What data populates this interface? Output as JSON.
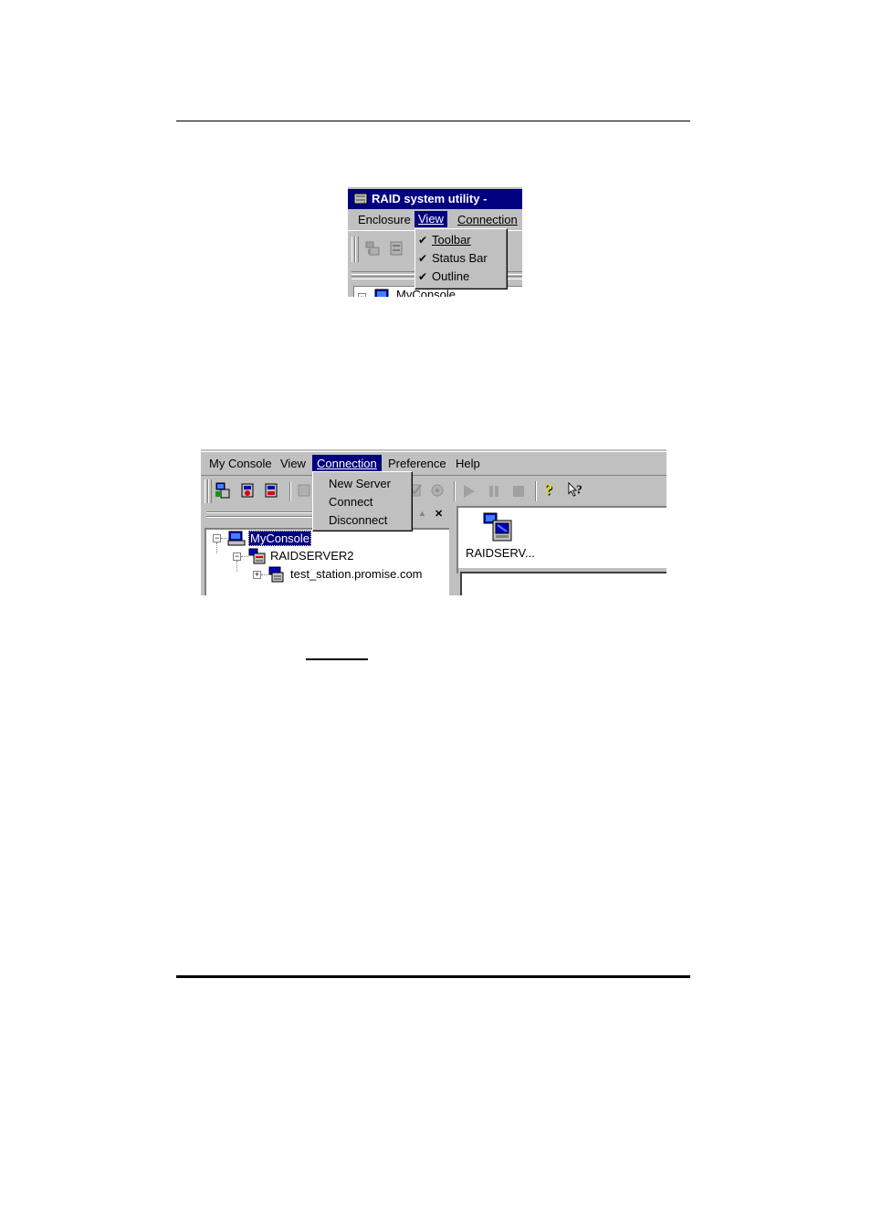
{
  "screenshot1": {
    "title": "RAID system utility -",
    "menu": [
      "Enclosure",
      "View",
      "Connection"
    ],
    "active_menu": "View",
    "view_menu_items": [
      {
        "label": "Toolbar",
        "checked": true,
        "accel_index": 0
      },
      {
        "label": "Status Bar",
        "checked": true,
        "accel_index": 0
      },
      {
        "label": "Outline",
        "checked": true,
        "accel_index": 0
      }
    ],
    "tree_root": "MyConsole"
  },
  "screenshot2": {
    "menu": [
      "My Console",
      "View",
      "Connection",
      "Preference",
      "Help"
    ],
    "active_menu": "Connection",
    "connection_menu_items": [
      "New Server",
      "Connect",
      "Disconnect"
    ],
    "pane_controls": [
      "▲",
      "✕"
    ],
    "tree": [
      {
        "label": "MyConsole",
        "selected": true,
        "expander": "−"
      },
      {
        "label": "RAIDSERVER2",
        "selected": false,
        "expander": "−"
      },
      {
        "label": "test_station.promise.com",
        "selected": false,
        "expander": "+"
      }
    ],
    "right_pane_item": "RAIDSERV..."
  },
  "colors": {
    "window_face": "#c0c0c0",
    "selection": "#000080",
    "shadow": "#808080"
  }
}
